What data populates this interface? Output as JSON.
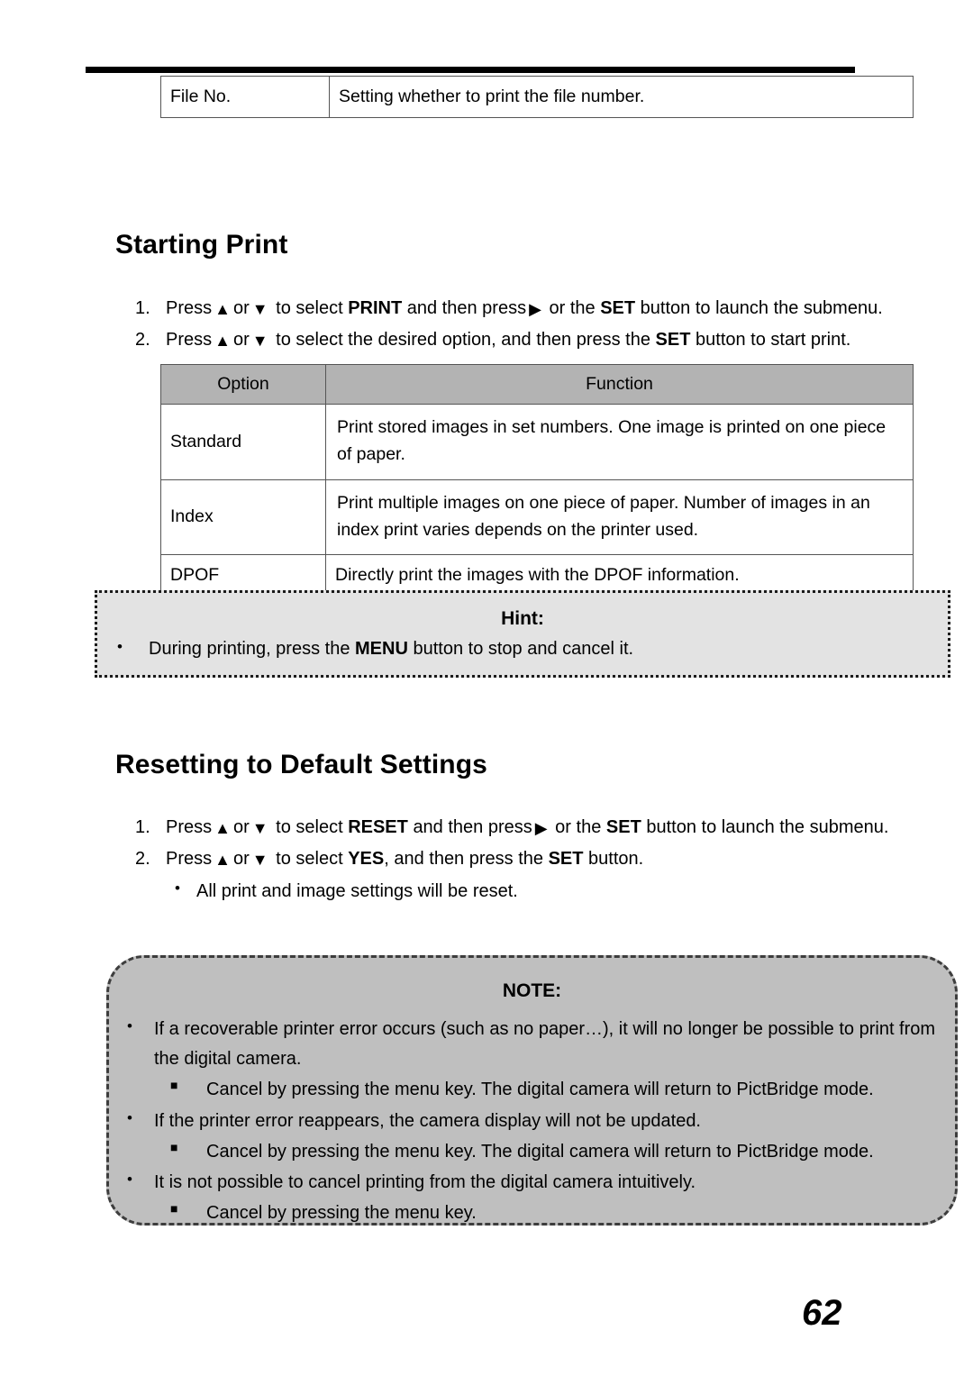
{
  "page": {
    "number": "62"
  },
  "file_no_table": {
    "rows": [
      {
        "option": "File No.",
        "function": "Setting whether to print the file number."
      }
    ]
  },
  "starting_print": {
    "heading": "Starting Print",
    "steps": [
      {
        "num": "1.",
        "pre": "Press",
        "icon_up": "up-triangle-icon",
        "mid1": "or",
        "icon_down": "down-triangle-icon",
        "mid2": "to select",
        "kw1": "PRINT",
        "mid3": "and then press",
        "icon_right": "right-triangle-icon",
        "mid4": "or the",
        "kw2": "SET",
        "tail": "button to launch the submenu."
      },
      {
        "num": "2.",
        "pre": "Press",
        "icon_up": "up-triangle-icon",
        "mid1": "or",
        "icon_down": "down-triangle-icon",
        "mid2": "to select the desired option, and then press the",
        "kw2": "SET",
        "tail": "button to start print."
      }
    ],
    "table": {
      "headers": [
        "Option",
        "Function"
      ],
      "rows": [
        {
          "option": "Standard",
          "function": "Print stored images in set numbers.    One image is printed on one piece of paper."
        },
        {
          "option": "Index",
          "function": "Print multiple images on one piece of paper.    Number of images in an index print varies depends on the printer used."
        },
        {
          "option": "DPOF",
          "function": "Directly print the images with the DPOF information."
        }
      ]
    }
  },
  "hint": {
    "title": "Hint:",
    "bullet_glyph": "•",
    "items": [
      {
        "pre": "During printing, press the",
        "kw": "MENU",
        "tail": "button to stop and cancel it."
      }
    ]
  },
  "resetting": {
    "heading": "Resetting to Default Settings",
    "steps": [
      {
        "num": "1.",
        "pre": "Press",
        "icon_up": "up-triangle-icon",
        "mid1": "or",
        "icon_down": "down-triangle-icon",
        "mid2": "to select",
        "kw1": "RESET",
        "mid3": "and then press",
        "icon_right": "right-triangle-icon",
        "mid4": "or the",
        "kw2": "SET",
        "tail": "button to launch the submenu."
      },
      {
        "num": "2.",
        "pre": "Press",
        "icon_up": "up-triangle-icon",
        "mid1": "or",
        "icon_down": "down-triangle-icon",
        "mid2": "to select",
        "kw1": "YES",
        "mid3": ", and then press the",
        "kw2": "SET",
        "tail": "button."
      }
    ],
    "subbullet": {
      "glyph": "•",
      "text": "All print and image settings will be reset."
    }
  },
  "note": {
    "title": "NOTE:",
    "bullet_glyph": "•",
    "square_glyph": "■",
    "items": [
      {
        "text": "If a recoverable printer error occurs (such as no paper…), it will no longer be possible to print from the digital camera.",
        "sub": "Cancel by pressing the menu key. The digital camera will return to PictBridge mode."
      },
      {
        "text": "If the printer error reappears, the camera display will not be updated.",
        "sub": "Cancel by pressing the menu key. The digital camera will return to PictBridge mode."
      },
      {
        "text": "It is not possible to cancel printing from the digital camera intuitively.",
        "sub": "Cancel by pressing the menu key."
      }
    ]
  },
  "colors": {
    "table_header_gray": "#b3b3b3",
    "hint_bg": "#e3e3e3",
    "note_bg": "#bfbfbf",
    "rule_black": "#000000"
  }
}
